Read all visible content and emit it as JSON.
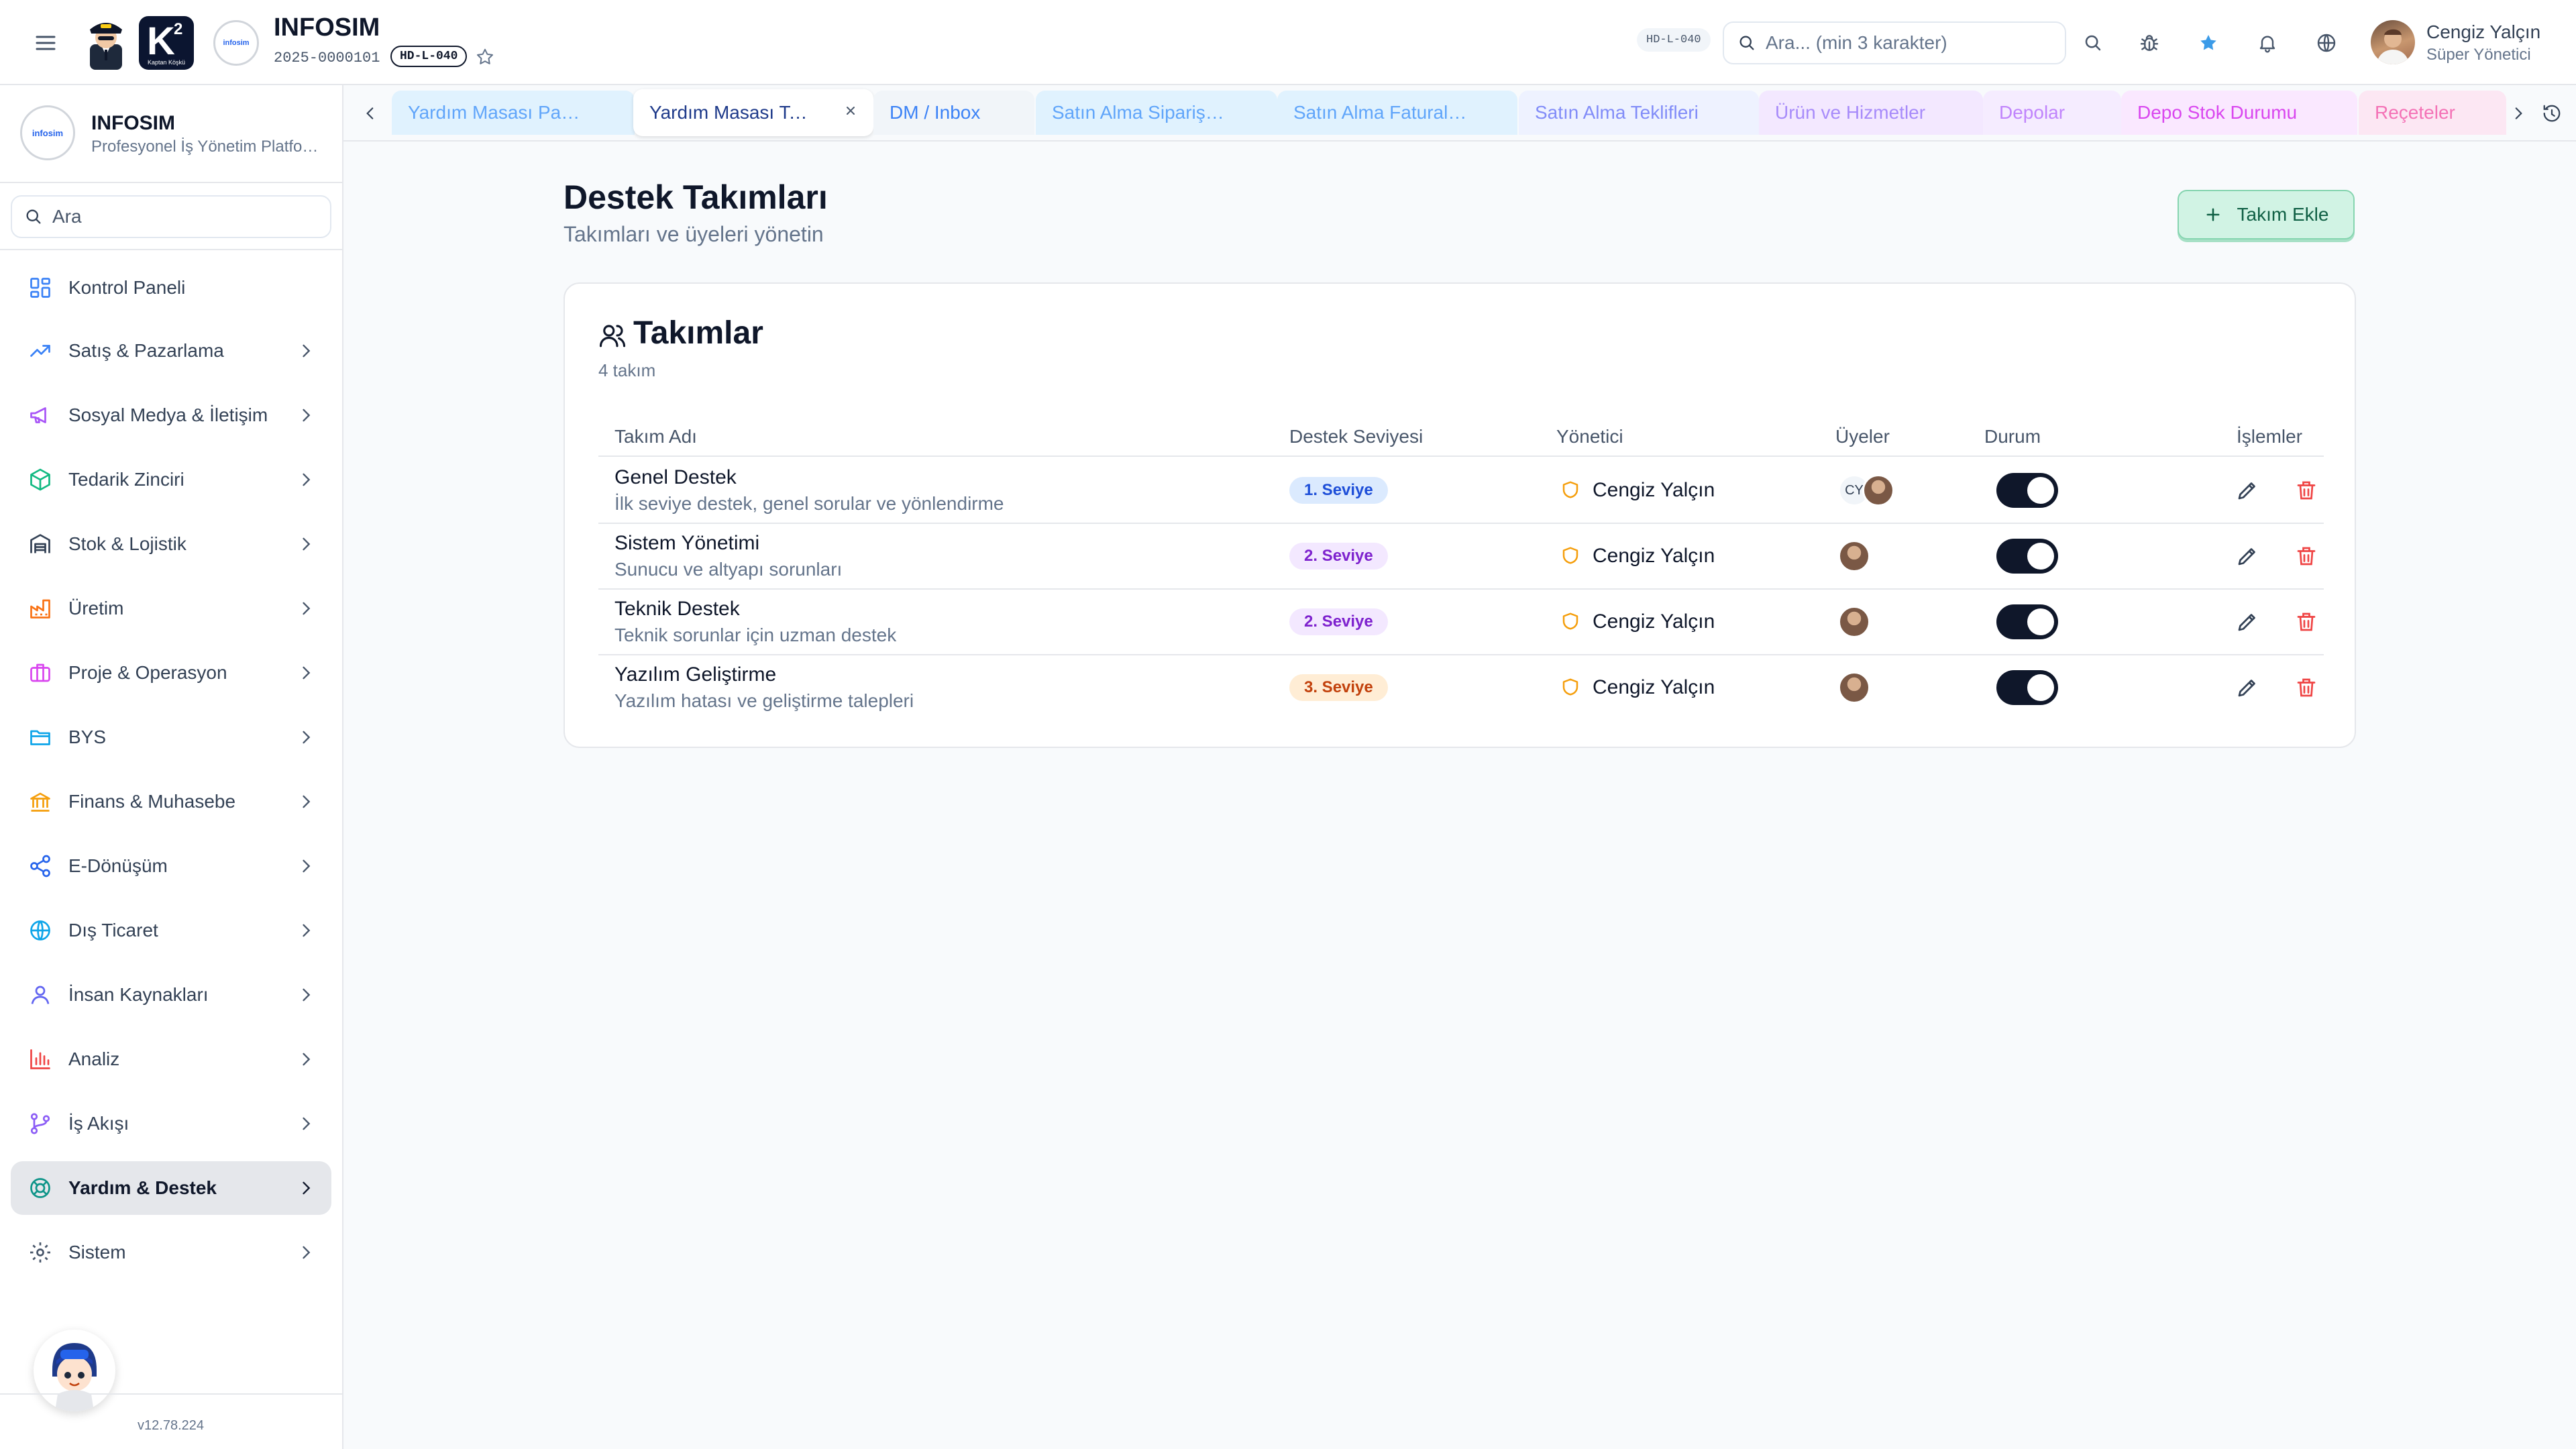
{
  "header": {
    "app_title": "INFOSIM",
    "app_code": "2025-0000101",
    "code_badge": "HD-L-040",
    "hd_badge": "HD-L-040",
    "search_placeholder": "Ara... (min 3 karakter)",
    "k2_cap": "Kaptan Köşkü",
    "logo_text": "infosim",
    "user_name": "Cengiz Yalçın",
    "user_role": "Süper Yönetici",
    "icons": [
      "menu-icon",
      "star-icon",
      "search-icon",
      "bug-icon",
      "favorite-star-icon",
      "bell-icon",
      "globe-icon"
    ]
  },
  "sidebar": {
    "title": "INFOSIM",
    "subtitle": "Profesyonel İş Yönetim Platformu",
    "logo_text": "infosim",
    "search_placeholder": "Ara",
    "version": "v12.78.224",
    "items": [
      {
        "label": "Kontrol Paneli",
        "icon": "dashboard-icon",
        "color": "#3b82f6"
      },
      {
        "label": "Satış & Pazarlama",
        "icon": "trending-up-icon",
        "color": "#3b82f6"
      },
      {
        "label": "Sosyal Medya & İletişim",
        "icon": "megaphone-icon",
        "color": "#a855f7"
      },
      {
        "label": "Tedarik Zinciri",
        "icon": "package-icon",
        "color": "#10b981"
      },
      {
        "label": "Stok & Lojistik",
        "icon": "warehouse-icon",
        "color": "#334155"
      },
      {
        "label": "Üretim",
        "icon": "factory-icon",
        "color": "#f97316"
      },
      {
        "label": "Proje & Operasyon",
        "icon": "briefcase-icon",
        "color": "#d946ef"
      },
      {
        "label": "BYS",
        "icon": "folder-icon",
        "color": "#0ea5e9"
      },
      {
        "label": "Finans & Muhasebe",
        "icon": "bank-icon",
        "color": "#f59e0b"
      },
      {
        "label": "E-Dönüşüm",
        "icon": "share-icon",
        "color": "#2563eb"
      },
      {
        "label": "Dış Ticaret",
        "icon": "globe-icon",
        "color": "#0ea5e9"
      },
      {
        "label": "İnsan Kaynakları",
        "icon": "user-icon",
        "color": "#6366f1"
      },
      {
        "label": "Analiz",
        "icon": "bar-chart-icon",
        "color": "#ef4444"
      },
      {
        "label": "İş Akışı",
        "icon": "git-branch-icon",
        "color": "#8b5cf6"
      },
      {
        "label": "Yardım & Destek",
        "icon": "lifebuoy-icon",
        "color": "#0d9488",
        "active": true
      },
      {
        "label": "Sistem",
        "icon": "settings-icon",
        "color": "#475569"
      }
    ]
  },
  "tabs": [
    {
      "label": "Yardım Masası Panosu",
      "color": "#60a5fa",
      "bg": "#e0f2fe"
    },
    {
      "label": "Yardım Masası Takımları",
      "color": "#1e3a8a",
      "bg": "#ffffff",
      "active": true
    },
    {
      "label": "DM / Inbox",
      "color": "#3b82f6",
      "bg": "#f1f5f9"
    },
    {
      "label": "Satın Alma Siparişleri",
      "color": "#60a5fa",
      "bg": "#e0f2fe"
    },
    {
      "label": "Satın Alma Faturaları",
      "color": "#60a5fa",
      "bg": "#e0f2fe"
    },
    {
      "label": "Satın Alma Teklifleri",
      "color": "#818cf8",
      "bg": "#eef2ff"
    },
    {
      "label": "Ürün ve Hizmetler",
      "color": "#a78bfa",
      "bg": "#f3e8ff"
    },
    {
      "label": "Depolar",
      "color": "#c084fc",
      "bg": "#f5ecff"
    },
    {
      "label": "Depo Stok Durumu",
      "color": "#d946ef",
      "bg": "#fae8ff"
    },
    {
      "label": "Reçeteler",
      "color": "#f472b6",
      "bg": "#fce7f3"
    }
  ],
  "main": {
    "title": "Destek Takımları",
    "subtitle": "Takımları ve üyeleri yönetin",
    "add_button": "Takım Ekle",
    "card": {
      "title": "Takımlar",
      "count": "4 takım",
      "columns": [
        "Takım Adı",
        "Destek Seviyesi",
        "Yönetici",
        "Üyeler",
        "Durum",
        "İşlemler"
      ],
      "rows": [
        {
          "name": "Genel Destek",
          "desc": "İlk seviye destek, genel sorular ve yönlendirme",
          "level": "1. Seviye",
          "level_color": "#1d4ed8",
          "level_bg": "#dbeafe",
          "manager": "Cengiz Yalçın",
          "member_initials": "CY",
          "member_count": 2,
          "active": true
        },
        {
          "name": "Sistem Yönetimi",
          "desc": "Sunucu ve altyapı sorunları",
          "level": "2. Seviye",
          "level_color": "#7e22ce",
          "level_bg": "#f3e8ff",
          "manager": "Cengiz Yalçın",
          "member_initials": "",
          "member_count": 1,
          "active": true
        },
        {
          "name": "Teknik Destek",
          "desc": "Teknik sorunlar için uzman destek",
          "level": "2. Seviye",
          "level_color": "#7e22ce",
          "level_bg": "#f3e8ff",
          "manager": "Cengiz Yalçın",
          "member_initials": "",
          "member_count": 1,
          "active": true
        },
        {
          "name": "Yazılım Geliştirme",
          "desc": "Yazılım hatası ve geliştirme talepleri",
          "level": "3. Seviye",
          "level_color": "#c2410c",
          "level_bg": "#ffedd5",
          "manager": "Cengiz Yalçın",
          "member_initials": "",
          "member_count": 1,
          "active": true
        }
      ]
    }
  },
  "colors": {
    "accent": "#0f172a",
    "danger": "#ef4444",
    "shield": "#f59e0b",
    "success_bg": "#d1f3e4"
  }
}
